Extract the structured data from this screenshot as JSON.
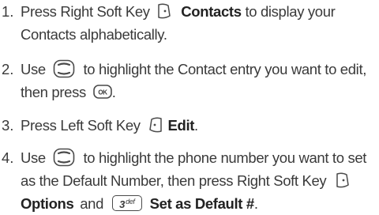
{
  "steps": [
    {
      "number": "1.",
      "line1_pre": "Press Right Soft Key",
      "line1_bold": "Contacts",
      "line1_post": "to display your",
      "line2": "Contacts alphabetically."
    },
    {
      "number": "2.",
      "line1_pre": "Use",
      "line1_post": "to highlight the Contact entry you want to edit,",
      "line2_pre": "then press",
      "line2_post": "."
    },
    {
      "number": "3.",
      "line1_pre": "Press Left Soft Key",
      "line1_bold": "Edit",
      "line1_post": "."
    },
    {
      "number": "4.",
      "line1_pre": "Use",
      "line1_post": "to highlight the phone number you want to set",
      "line2_pre": "as the Default Number, then press  Right Soft Key",
      "line3_bold_a": "Options",
      "line3_mid": "and",
      "line3_bold_b": "Set as Default #",
      "line3_post": "."
    }
  ],
  "keys": {
    "ok_label": "OK",
    "three_digit": "3",
    "three_letters": "def"
  },
  "icons": [
    "right-soft-key-icon",
    "navigation-key-icon",
    "ok-key-icon",
    "left-soft-key-icon",
    "number-3-key-icon"
  ]
}
